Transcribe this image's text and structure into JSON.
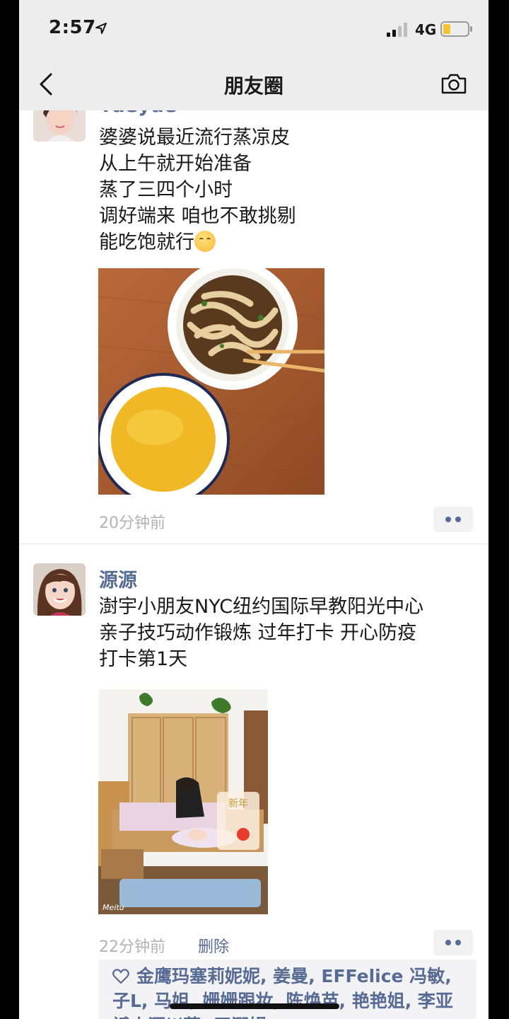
{
  "status_bar": {
    "time": "2:57",
    "network": "4G"
  },
  "nav": {
    "title": "朋友圈"
  },
  "posts": [
    {
      "author": "Yueyue",
      "lines": [
        "婆婆说最近流行蒸凉皮",
        "从上午就开始准备",
        "蒸了三四个小时",
        "调好端来 咱也不敢挑剔",
        "能吃饱就行"
      ],
      "emoji": "smiling-face",
      "time": "20分钟前"
    },
    {
      "author": "源源",
      "lines": [
        "澍宇小朋友NYC纽约国际早教阳光中心",
        "亲子技巧动作锻炼  过年打卡 开心防疫",
        "打卡第1天"
      ],
      "time": "22分钟前",
      "delete_label": "删除",
      "photo_stamp": "新年",
      "photo_watermark": "Meitu",
      "likes": {
        "line1": "金鹰玛塞莉妮妮, 姜曼, EFFelice 冯敏,",
        "line2": "子L, 马姐, 姗姗跟妆, 陈焕苗, 艳艳姐, 李亚",
        "line3": "斌小潭川菜, 王潤娟"
      }
    }
  ],
  "colors": {
    "link": "#576b95",
    "bar_bg": "#ededed",
    "muted": "#b2b2b2"
  },
  "icons": [
    "location-arrow-icon",
    "signal-icon",
    "battery-icon",
    "back-icon",
    "camera-icon",
    "more-icon",
    "heart-icon"
  ]
}
